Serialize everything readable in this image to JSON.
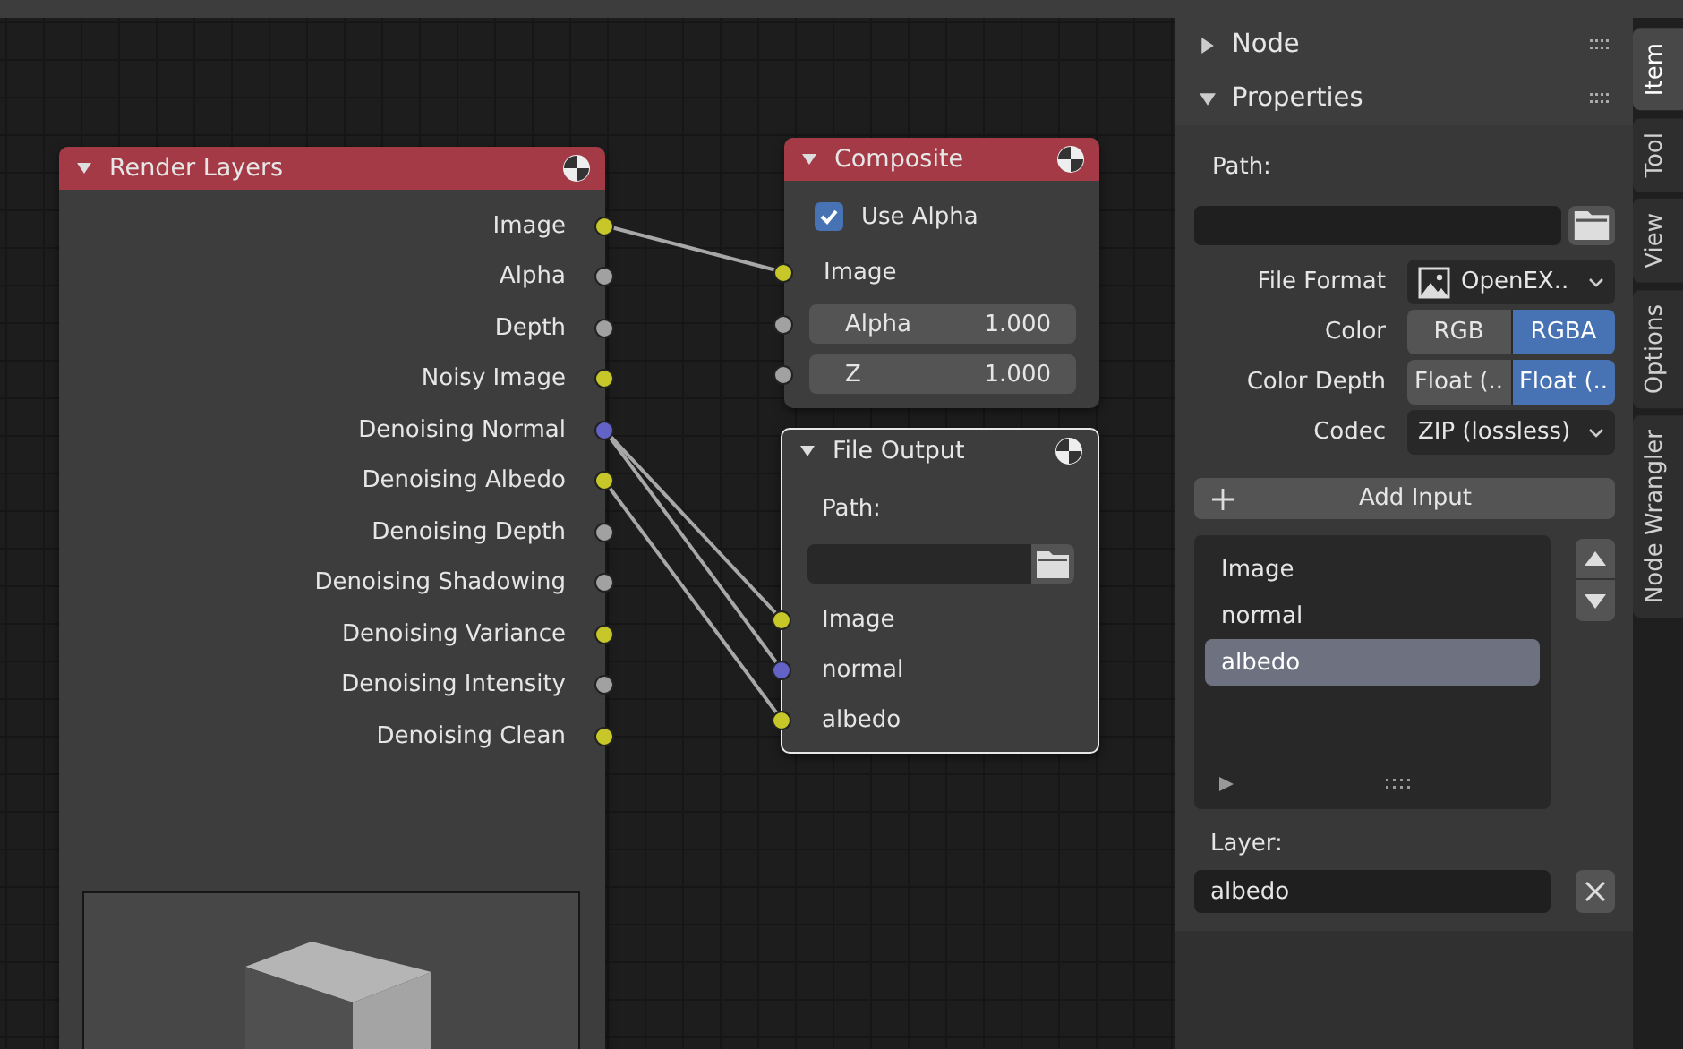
{
  "render_layers_node": {
    "title": "Render Layers",
    "expanded": true,
    "outputs": [
      {
        "label": "Image",
        "color": "#c7c729"
      },
      {
        "label": "Alpha",
        "color": "#a1a1a1"
      },
      {
        "label": "Depth",
        "color": "#a1a1a1"
      },
      {
        "label": "Noisy Image",
        "color": "#c7c729"
      },
      {
        "label": "Denoising Normal",
        "color": "#6363c7"
      },
      {
        "label": "Denoising Albedo",
        "color": "#c7c729"
      },
      {
        "label": "Denoising Depth",
        "color": "#a1a1a1"
      },
      {
        "label": "Denoising Shadowing",
        "color": "#a1a1a1"
      },
      {
        "label": "Denoising Variance",
        "color": "#c7c729"
      },
      {
        "label": "Denoising Intensity",
        "color": "#a1a1a1"
      },
      {
        "label": "Denoising Clean",
        "color": "#c7c729"
      }
    ]
  },
  "composite_node": {
    "title": "Composite",
    "expanded": true,
    "use_alpha": {
      "label": "Use Alpha",
      "checked": true
    },
    "inputs": [
      {
        "kind": "socket",
        "label": "Image",
        "color": "#c7c729"
      },
      {
        "kind": "value",
        "label": "Alpha",
        "value": "1.000",
        "color": "#a1a1a1"
      },
      {
        "kind": "value",
        "label": "Z",
        "value": "1.000",
        "color": "#a1a1a1"
      }
    ]
  },
  "file_output_node": {
    "title": "File Output",
    "expanded": true,
    "selected": true,
    "path_label": "Path:",
    "inputs": [
      {
        "label": "Image",
        "color": "#c7c729"
      },
      {
        "label": "normal",
        "color": "#6363c7"
      },
      {
        "label": "albedo",
        "color": "#c7c729"
      }
    ]
  },
  "sidebar": {
    "panels": [
      {
        "title": "Node",
        "expanded": false
      },
      {
        "title": "Properties",
        "expanded": true
      }
    ],
    "properties": {
      "path_label": "Path:",
      "file_format": {
        "label": "File Format",
        "value": "OpenEX.."
      },
      "color": {
        "label": "Color",
        "options": [
          {
            "label": "RGB",
            "selected": false
          },
          {
            "label": "RGBA",
            "selected": true
          }
        ]
      },
      "color_depth": {
        "label": "Color Depth",
        "options": [
          {
            "label": "Float (..",
            "selected": false
          },
          {
            "label": "Float (..",
            "selected": true
          }
        ]
      },
      "codec": {
        "label": "Codec",
        "value": "ZIP (lossless)"
      },
      "add_input_button": "Add Input",
      "inputs_list": [
        {
          "label": "Image",
          "selected": false
        },
        {
          "label": "normal",
          "selected": false
        },
        {
          "label": "albedo",
          "selected": true
        }
      ],
      "layer_label": "Layer:",
      "layer_value": "albedo"
    },
    "tabs": [
      {
        "label": "Item",
        "selected": true
      },
      {
        "label": "Tool",
        "selected": false
      },
      {
        "label": "View",
        "selected": false
      },
      {
        "label": "Options",
        "selected": false
      },
      {
        "label": "Node Wrangler",
        "selected": false
      }
    ]
  }
}
